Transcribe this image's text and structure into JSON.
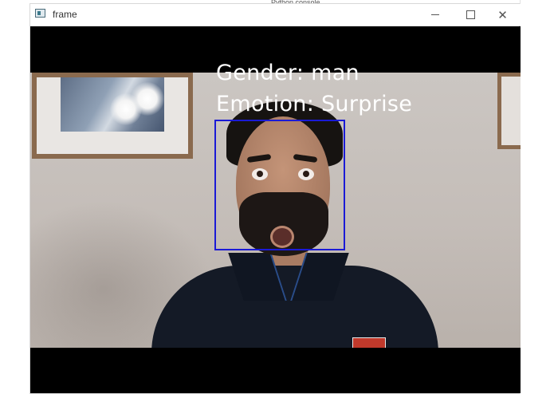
{
  "background": {
    "snippet": "Python console"
  },
  "window": {
    "title": "frame",
    "controls": {
      "minimize": "minimize",
      "maximize": "maximize",
      "close": "✕"
    }
  },
  "detection": {
    "gender_label": "Gender: man",
    "emotion_label": "Emotion: Surprise",
    "box_color": "#1a1ad6",
    "text_color": "#ffffff"
  }
}
